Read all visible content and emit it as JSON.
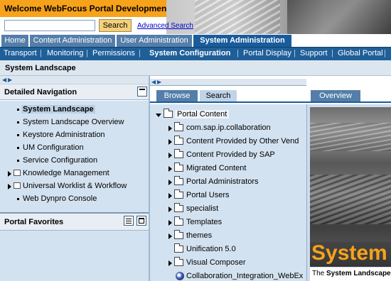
{
  "app": {
    "title": "Welcome WebFocus Portal Development"
  },
  "search": {
    "value": "",
    "placeholder": "",
    "button": "Search",
    "advanced": "Advanced Search"
  },
  "top_tabs": [
    {
      "label": "Home",
      "active": false
    },
    {
      "label": "Content Administration",
      "active": false
    },
    {
      "label": "User Administration",
      "active": false
    },
    {
      "label": "System Administration",
      "active": true
    }
  ],
  "sub_nav": [
    {
      "label": "Transport",
      "active": false
    },
    {
      "label": "Monitoring",
      "active": false
    },
    {
      "label": "Permissions",
      "active": false
    },
    {
      "label": "System Configuration",
      "active": true
    },
    {
      "label": "Portal Display",
      "active": false
    },
    {
      "label": "Support",
      "active": false
    },
    {
      "label": "Global Portal",
      "active": false
    }
  ],
  "page": {
    "title": "System Landscape"
  },
  "detailed_navigation": {
    "title": "Detailed Navigation",
    "items": [
      {
        "label": "System Landscape",
        "type": "leaf",
        "active": true
      },
      {
        "label": "System Landscape Overview",
        "type": "leaf",
        "active": false
      },
      {
        "label": "Keystore Administration",
        "type": "leaf",
        "active": false
      },
      {
        "label": "UM Configuration",
        "type": "leaf",
        "active": false
      },
      {
        "label": "Service Configuration",
        "type": "leaf",
        "active": false
      },
      {
        "label": "Knowledge Management",
        "type": "folder",
        "active": false
      },
      {
        "label": "Universal Worklist & Workflow",
        "type": "folder",
        "active": false
      },
      {
        "label": "Web Dynpro Console",
        "type": "leaf",
        "active": false
      }
    ]
  },
  "portal_favorites": {
    "title": "Portal Favorites"
  },
  "middle_tabs": [
    {
      "label": "Browse",
      "active": false
    },
    {
      "label": "Search",
      "active": true
    }
  ],
  "tree": {
    "root": "Portal Content",
    "items": [
      {
        "label": "com.sap.ip.collaboration",
        "expandable": true,
        "kind": "folder"
      },
      {
        "label": "Content Provided by Other Vend",
        "expandable": true,
        "kind": "folder"
      },
      {
        "label": "Content Provided by SAP",
        "expandable": true,
        "kind": "folder"
      },
      {
        "label": "Migrated Content",
        "expandable": true,
        "kind": "folder"
      },
      {
        "label": "Portal Administrators",
        "expandable": true,
        "kind": "folder"
      },
      {
        "label": "Portal Users",
        "expandable": true,
        "kind": "folder"
      },
      {
        "label": "specialist",
        "expandable": true,
        "kind": "folder"
      },
      {
        "label": "Templates",
        "expandable": true,
        "kind": "folder"
      },
      {
        "label": "themes",
        "expandable": true,
        "kind": "folder"
      },
      {
        "label": "Unification 5.0",
        "expandable": false,
        "kind": "folder"
      },
      {
        "label": "Visual Composer",
        "expandable": true,
        "kind": "folder"
      },
      {
        "label": "Collaboration_Integration_WebEx",
        "expandable": false,
        "kind": "app"
      }
    ]
  },
  "overview": {
    "tab": "Overview",
    "banner_title": "System",
    "caption_prefix": "The ",
    "caption_bold": "System Landscape"
  },
  "colors": {
    "brand": "#f7a21b",
    "nav_dark": "#1f5f99",
    "tab_inactive": "#547ea9",
    "panel_bg": "#d3e2f0"
  }
}
